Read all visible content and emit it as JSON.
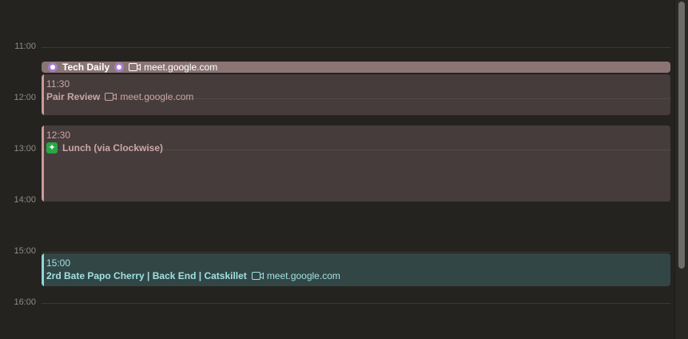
{
  "hours": [
    "11:00",
    "12:00",
    "13:00",
    "14:00",
    "15:00",
    "16:00"
  ],
  "events": {
    "tech_daily": {
      "title": "Tech Daily",
      "location": "meet.google.com",
      "icon": "octocat-icon",
      "color": "#8a7474"
    },
    "pair_review": {
      "time": "11:30",
      "title": "Pair Review",
      "location": "meet.google.com",
      "color": "#c79a97"
    },
    "lunch": {
      "time": "12:30",
      "title": "Lunch (via Clockwise)",
      "icon": "clockwise-spark-icon",
      "color": "#c79a97"
    },
    "bate_papo": {
      "time": "15:00",
      "title": "2rd Bate Papo Cherry | Back End | Catskillet",
      "location": "meet.google.com",
      "color": "#8fd6d6"
    }
  }
}
